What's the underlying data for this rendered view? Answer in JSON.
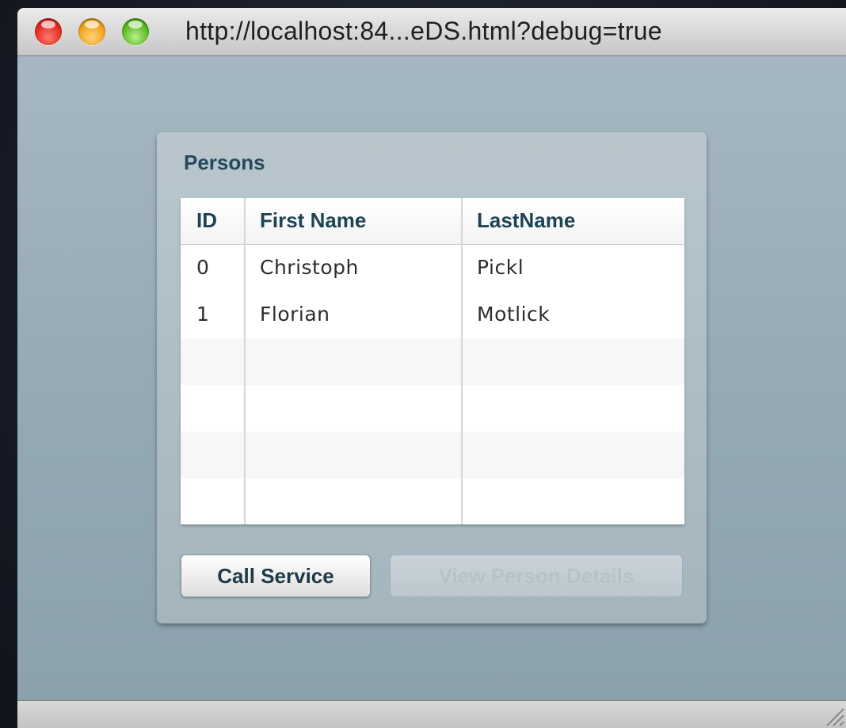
{
  "window": {
    "title": "http://localhost:84...eDS.html?debug=true"
  },
  "panel": {
    "title": "Persons",
    "table": {
      "columns": [
        "ID",
        "First Name",
        "LastName"
      ],
      "rows": [
        [
          "0",
          "Christoph",
          "Pickl"
        ],
        [
          "1",
          "Florian",
          "Motlick"
        ],
        [
          "",
          "",
          ""
        ],
        [
          "",
          "",
          ""
        ],
        [
          "",
          "",
          ""
        ],
        [
          "",
          "",
          ""
        ]
      ]
    },
    "buttons": {
      "call_service": "Call Service",
      "view_details": "View Person Details"
    }
  },
  "colors": {
    "accent_text": "#1e4353",
    "panel_bg": "#b0bfc7",
    "window_bg": "#94a9b4"
  },
  "icons": [
    "close-icon",
    "minimize-icon",
    "zoom-icon",
    "resize-grip-icon"
  ]
}
